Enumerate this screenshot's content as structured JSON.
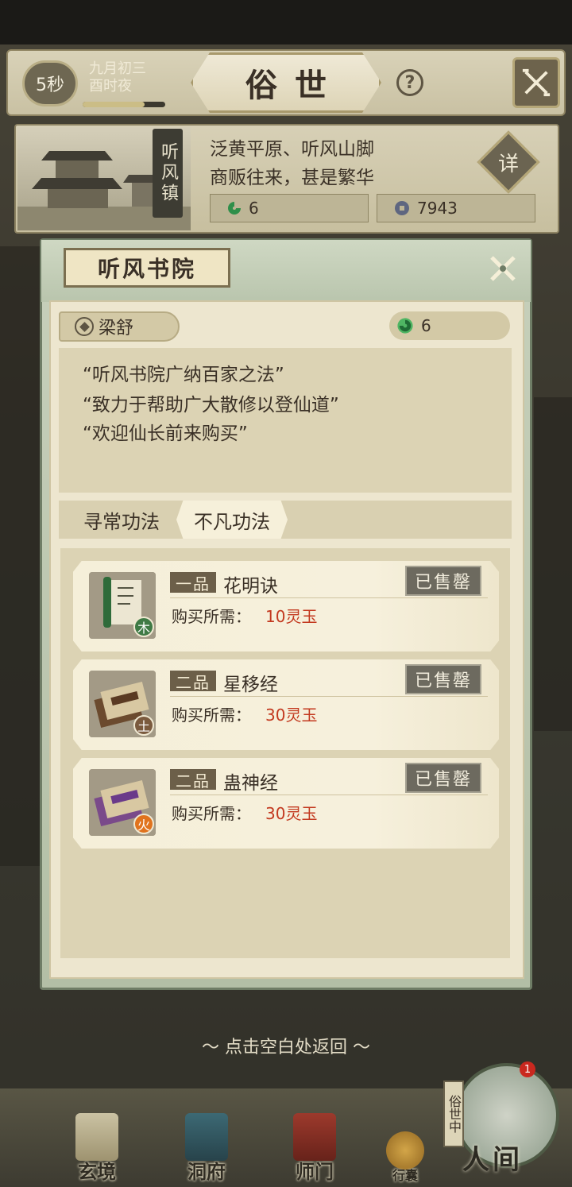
{
  "top_bar": {
    "timer": "5秒",
    "date_line1": "九月初三",
    "date_line2": "酉时夜",
    "timer_progress": 0.75,
    "title": "俗世",
    "help_glyph": "?",
    "exit_icon": "crossed-swords-icon"
  },
  "location": {
    "name": "听风镇",
    "description_line1": "泛黄平原、听风山脚",
    "description_line2": "商贩往来，甚是繁华",
    "detail_label": "详",
    "jade_count": "6",
    "coin_count": "7943"
  },
  "shop": {
    "title": "听风书院",
    "npc_name": "梁舒",
    "jade_count": "6",
    "quotes": [
      "“听风书院广纳百家之法”",
      "“致力于帮助广大散修以登仙道”",
      "“欢迎仙长前来购买”"
    ],
    "tabs": [
      {
        "label": "寻常功法",
        "active": false
      },
      {
        "label": "不凡功法",
        "active": true
      }
    ],
    "price_label": "购买所需：",
    "sold_label": "已售罄",
    "items": [
      {
        "grade": "一品",
        "name": "花明诀",
        "price": "10灵玉",
        "element": "木",
        "element_color": "#3f7a45",
        "scroll_color": "#2f6b3a"
      },
      {
        "grade": "二品",
        "name": "星移经",
        "price": "30灵玉",
        "element": "土",
        "element_color": "#7a5a3e",
        "scroll_color": "#5a3a22"
      },
      {
        "grade": "二品",
        "name": "蛊神经",
        "price": "30灵玉",
        "element": "火",
        "element_color": "#e0731e",
        "scroll_color": "#6a3a8a"
      }
    ]
  },
  "return_hint": "点击空白处返回",
  "nav": {
    "items": [
      {
        "label": "玄境",
        "icon": "scroll-icon"
      },
      {
        "label": "洞府",
        "icon": "pavilion-icon"
      },
      {
        "label": "师门",
        "icon": "banner-icon"
      },
      {
        "label": "行囊",
        "icon": "bag-icon"
      }
    ],
    "world_tag": "俗世中",
    "world_label": "人间",
    "world_badge": "1"
  },
  "colors": {
    "accent_red": "#c3391f",
    "panel_cream": "#ede6cf",
    "frame_green": "#b3bfa6"
  }
}
